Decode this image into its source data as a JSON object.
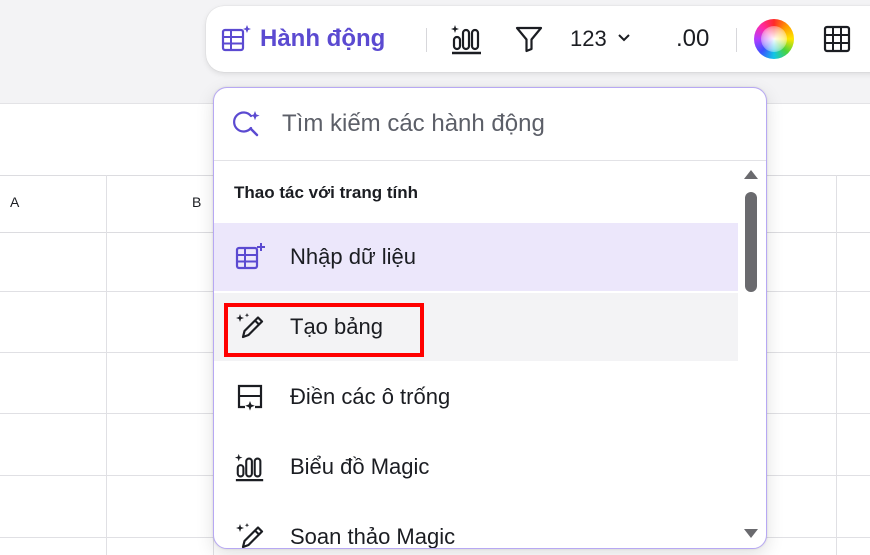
{
  "toolbar": {
    "actions_label": "Hành động",
    "number_format": "123",
    "decimal": ".00"
  },
  "sheet": {
    "columns": [
      "A",
      "B"
    ]
  },
  "panel": {
    "search_placeholder": "Tìm kiếm các hành động",
    "section_title": "Thao tác với trang tính",
    "items": [
      {
        "label": "Nhập dữ liệu",
        "icon": "table-add-icon"
      },
      {
        "label": "Tạo bảng",
        "icon": "magic-pen-icon"
      },
      {
        "label": "Điền các ô trống",
        "icon": "fill-cells-icon"
      },
      {
        "label": "Biểu đồ Magic",
        "icon": "magic-chart-icon"
      },
      {
        "label": "Soan thảo Magic",
        "icon": "magic-pen-icon"
      }
    ]
  },
  "colors": {
    "accent": "#5b4ad1",
    "selected_bg": "#ece7fb",
    "highlight": "#ff0000"
  }
}
